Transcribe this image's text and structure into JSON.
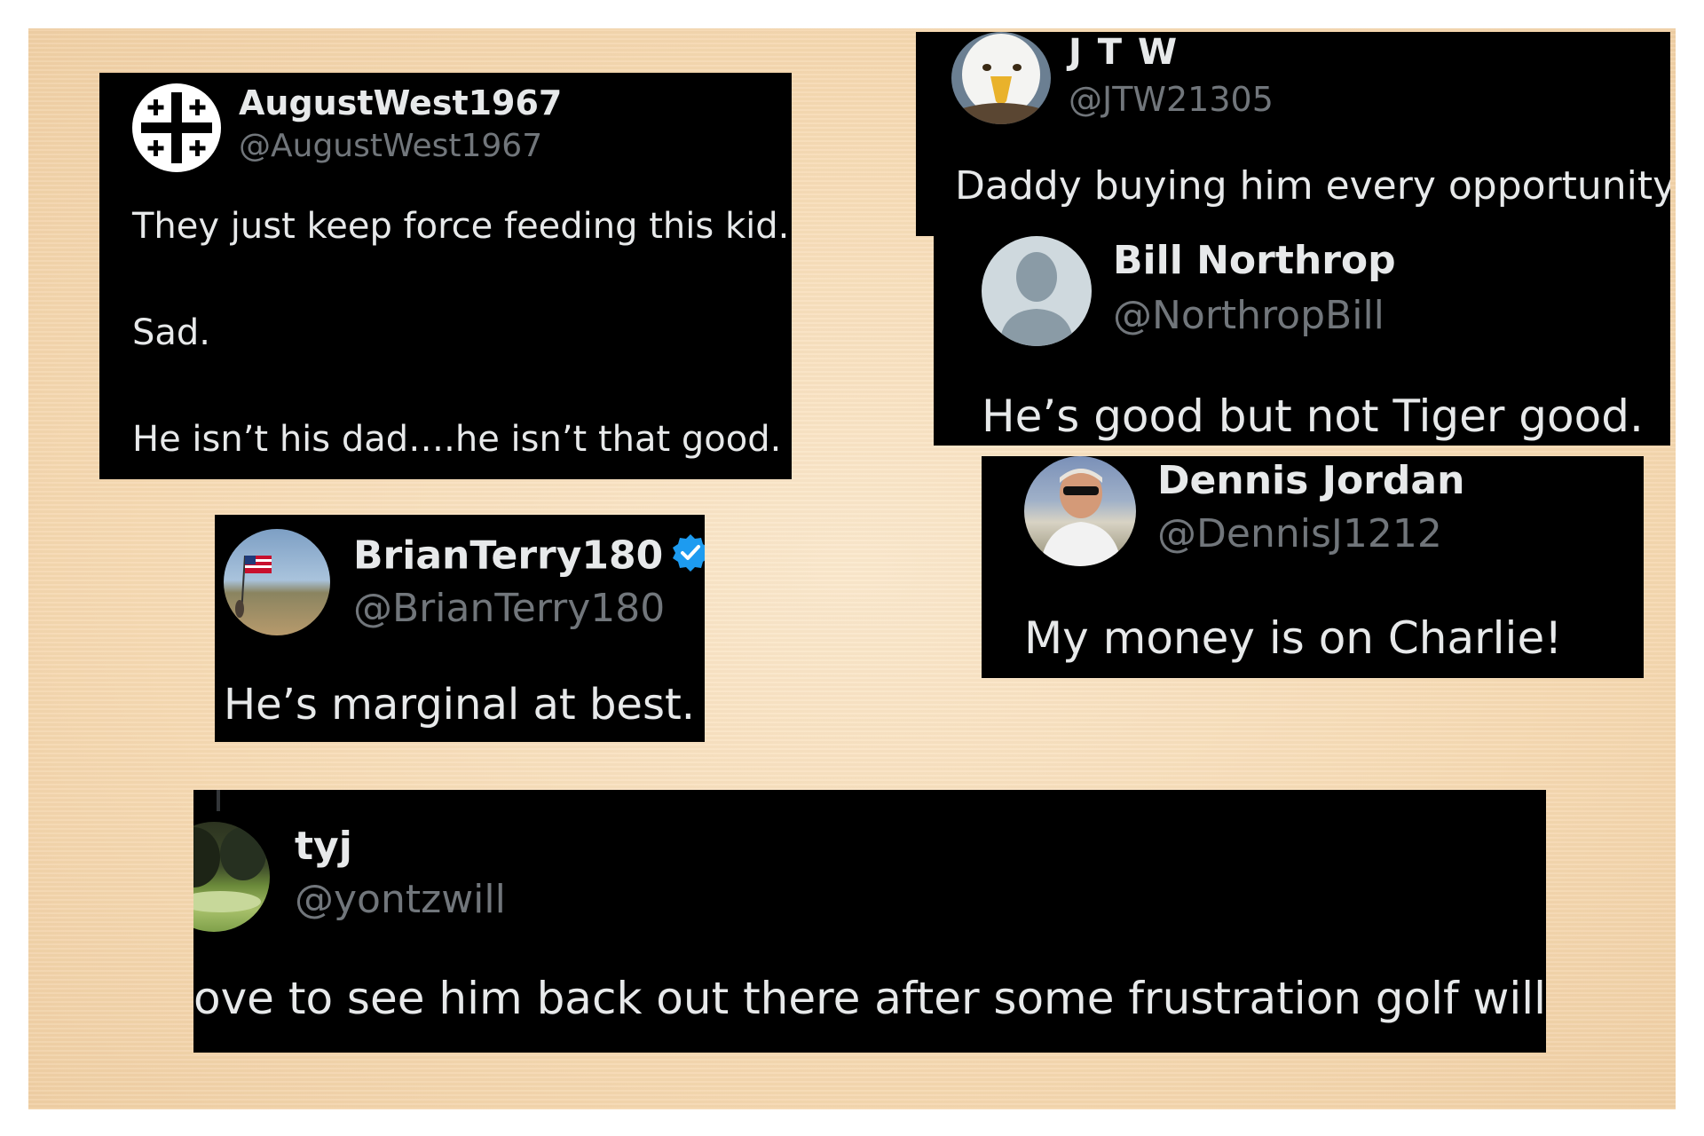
{
  "tweets": [
    {
      "name": "AugustWest1967",
      "handle": "@AugustWest1967",
      "lines": [
        "They just keep force feeding this kid.",
        "Sad.",
        "He isn’t his dad….he isn’t that good."
      ],
      "avatar_icon": "jerusalem-cross-icon"
    },
    {
      "name": "J T W",
      "handle": "@JTW21305",
      "lines": [
        "Daddy buying him every opportunity."
      ],
      "avatar_icon": "eagle-avatar"
    },
    {
      "name": "Bill Northrop",
      "handle": "@NorthropBill",
      "lines": [
        "He’s good but not Tiger good."
      ],
      "avatar_icon": "default-person-icon"
    },
    {
      "name": "Dennis Jordan",
      "handle": "@DennisJ1212",
      "lines": [
        "My money is on Charlie!"
      ],
      "avatar_icon": "man-photo-avatar"
    },
    {
      "name": "BrianTerry180",
      "handle": "@BrianTerry180",
      "lines": [
        "He’s marginal at best."
      ],
      "avatar_icon": "flag-photo-avatar",
      "verified": true
    },
    {
      "name": "tyj",
      "handle": "@yontzwill",
      "lines": [
        "ove to see him back out there after some frustration golf will do th"
      ],
      "avatar_icon": "golf-course-avatar"
    }
  ],
  "colors": {
    "card_bg": "#000000",
    "name": "#e7e9ea",
    "handle": "#71767b",
    "verified": "#1d9bf0",
    "background": "#f6d9b2"
  }
}
